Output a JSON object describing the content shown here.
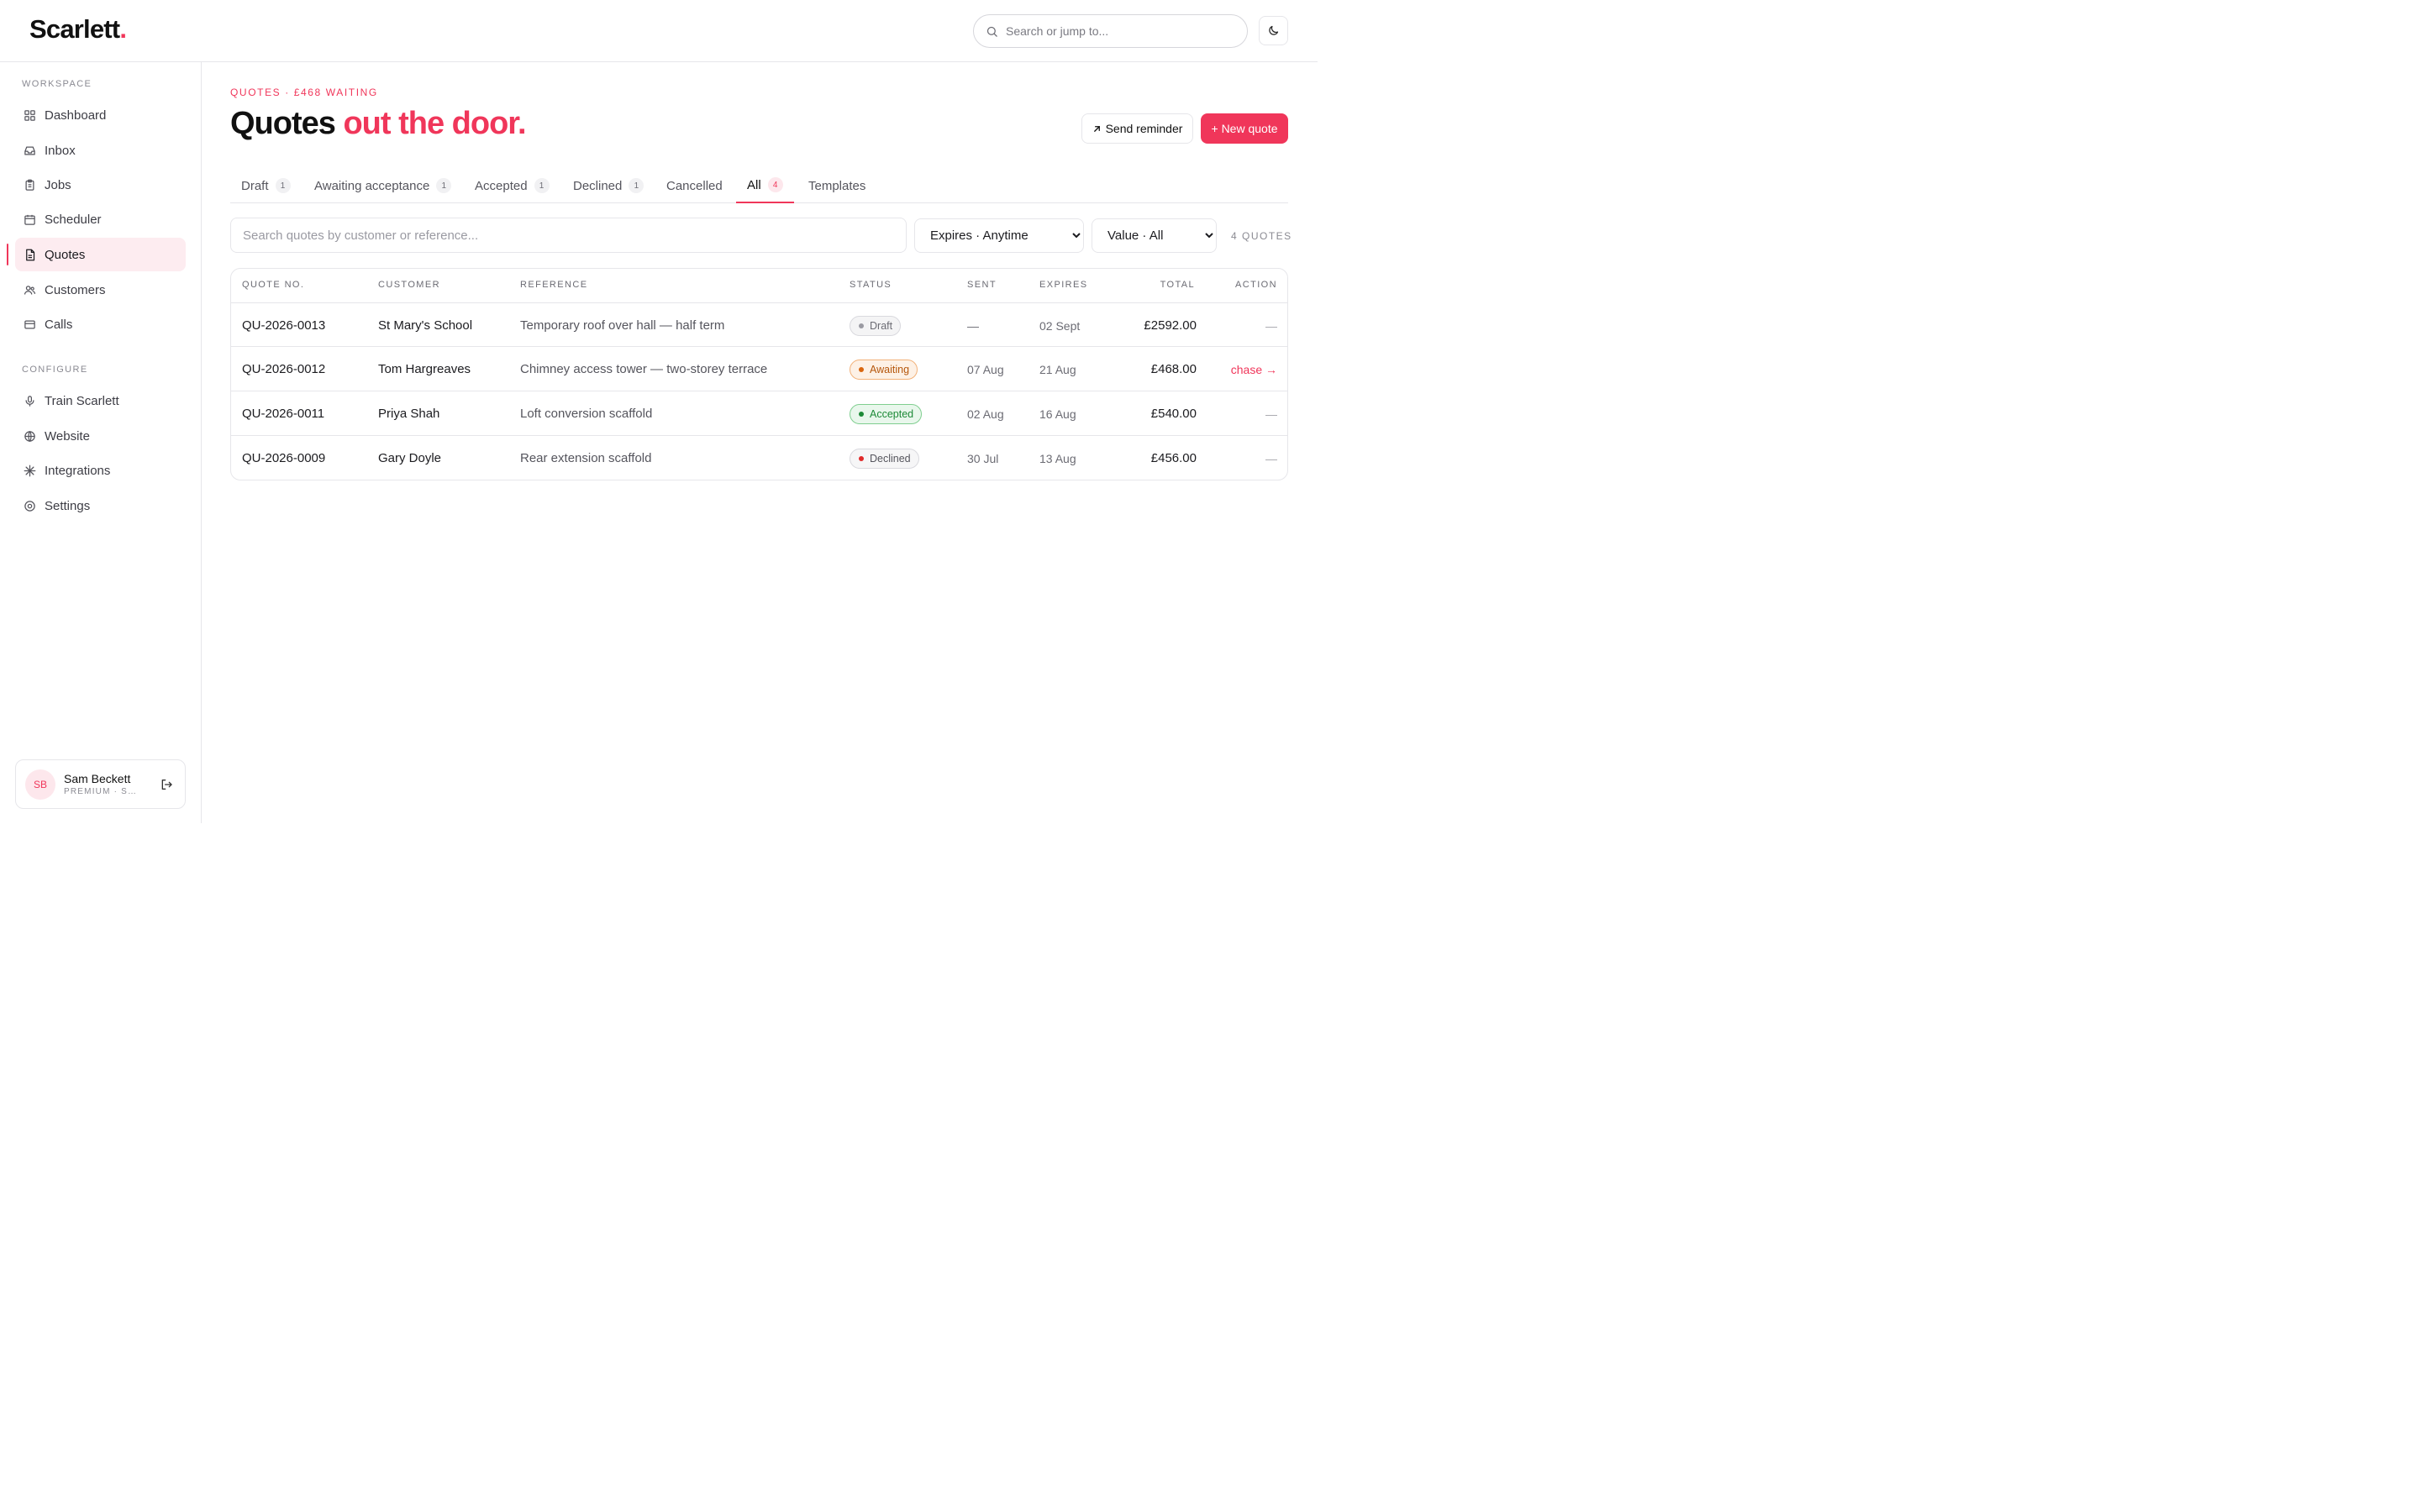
{
  "brand": {
    "name": "Scarlett",
    "dot": ".",
    "accent_color": "#f0365a"
  },
  "header": {
    "search_placeholder": "Search or jump to...",
    "theme_toggle_icon": "moon-icon"
  },
  "sidebar": {
    "workspace_label": "WORKSPACE",
    "workspace_items": [
      {
        "label": "Dashboard",
        "icon": "dashboard-icon"
      },
      {
        "label": "Inbox",
        "icon": "inbox-icon"
      },
      {
        "label": "Jobs",
        "icon": "clipboard-icon"
      },
      {
        "label": "Scheduler",
        "icon": "calendar-icon"
      },
      {
        "label": "Quotes",
        "icon": "document-icon",
        "active": true
      },
      {
        "label": "Customers",
        "icon": "users-icon"
      },
      {
        "label": "Calls",
        "icon": "card-icon"
      }
    ],
    "configure_label": "CONFIGURE",
    "configure_items": [
      {
        "label": "Train Scarlett",
        "icon": "microphone-icon"
      },
      {
        "label": "Website",
        "icon": "globe-icon"
      },
      {
        "label": "Integrations",
        "icon": "sparkle-icon"
      },
      {
        "label": "Settings",
        "icon": "settings-icon"
      }
    ],
    "user": {
      "initials": "SB",
      "name": "Sam Beckett",
      "plan": "PREMIUM · SCAFFOLDING"
    }
  },
  "page": {
    "eyebrow": "QUOTES · £468 WAITING",
    "title_main": "Quotes",
    "title_accent": "out the door.",
    "send_reminder_label": "Send reminder",
    "new_quote_label": "+ New quote"
  },
  "tabs": [
    {
      "label": "Draft",
      "count": "1"
    },
    {
      "label": "Awaiting acceptance",
      "count": "1"
    },
    {
      "label": "Accepted",
      "count": "1"
    },
    {
      "label": "Declined",
      "count": "1"
    },
    {
      "label": "Cancelled",
      "count": ""
    },
    {
      "label": "All",
      "count": "4",
      "active": true
    },
    {
      "label": "Templates",
      "count": ""
    }
  ],
  "filters": {
    "search_placeholder": "Search quotes by customer or reference...",
    "expires_selected": "Expires · Anytime",
    "value_selected": "Value · All",
    "count_label": "4 QUOTES"
  },
  "table": {
    "columns": [
      "QUOTE NO.",
      "CUSTOMER",
      "REFERENCE",
      "STATUS",
      "SENT",
      "EXPIRES",
      "TOTAL",
      "ACTION"
    ],
    "rows": [
      {
        "quote_no": "QU-2026-0013",
        "customer": "St Mary's School",
        "reference": "Temporary roof over hall — half term",
        "status": "Draft",
        "status_key": "draft",
        "sent": "—",
        "expires": "02 Sept",
        "total": "£2592.00",
        "action": "—"
      },
      {
        "quote_no": "QU-2026-0012",
        "customer": "Tom Hargreaves",
        "reference": "Chimney access tower — two-storey terrace",
        "status": "Awaiting",
        "status_key": "awaiting",
        "sent": "07 Aug",
        "expires": "21 Aug",
        "total": "£468.00",
        "action": "chase →"
      },
      {
        "quote_no": "QU-2026-0011",
        "customer": "Priya Shah",
        "reference": "Loft conversion scaffold",
        "status": "Accepted",
        "status_key": "accepted",
        "sent": "02 Aug",
        "expires": "16 Aug",
        "total": "£540.00",
        "action": "—"
      },
      {
        "quote_no": "QU-2026-0009",
        "customer": "Gary Doyle",
        "reference": "Rear extension scaffold",
        "status": "Declined",
        "status_key": "declined",
        "sent": "30 Jul",
        "expires": "13 Aug",
        "total": "£456.00",
        "action": "—"
      }
    ]
  }
}
